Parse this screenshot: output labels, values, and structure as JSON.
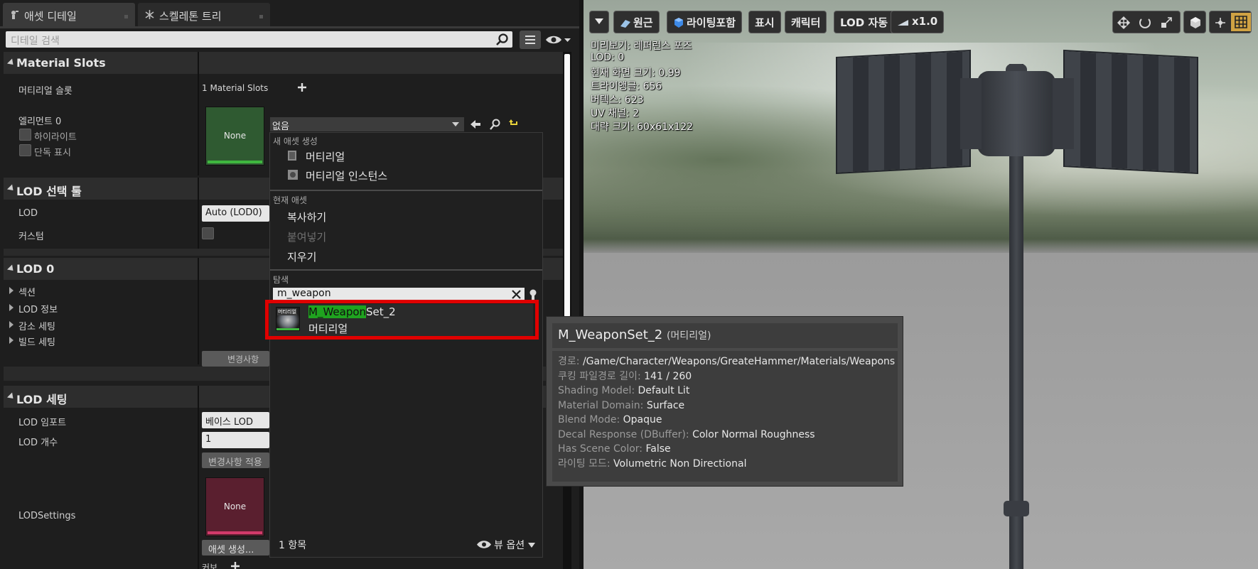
{
  "tabs": [
    {
      "label": "애셋 디테일",
      "active": true
    },
    {
      "label": "스켈레톤 트리",
      "active": false
    }
  ],
  "details": {
    "search_placeholder": "디테일 검색",
    "categories": {
      "material_slots": "Material Slots",
      "lod_picker": "LOD 선택 툴",
      "lod0": "LOD 0",
      "lod_settings": "LOD 세팅"
    },
    "material_slots": {
      "label": "머티리얼 슬롯",
      "value": "1 Material Slots",
      "element_label": "엘리먼트 0",
      "highlight_label": "하이라이트",
      "isolate_label": "단독 표시",
      "thumb_text": "None",
      "combo_value": "없음"
    },
    "lod_picker": {
      "lod_label": "LOD",
      "lod_value": "Auto (LOD0)",
      "custom_label": "커스텀"
    },
    "lod0": {
      "sections": [
        "섹션",
        "LOD 정보",
        "감소 세팅",
        "빌드 세팅"
      ],
      "apply_button": "변경사항 적"
    },
    "lod_settings": {
      "import_label": "LOD 임포트",
      "import_value": "베이스 LOD",
      "count_label": "LOD 개수",
      "count_value": "1",
      "apply_button": "변경사항 적용",
      "settings_label": "LODSettings",
      "thumb_text": "None",
      "create_button": "애셋 생성...",
      "bottom_label": "커보"
    }
  },
  "menu": {
    "create_header": "새 애셋 생성",
    "create_items": [
      "머티리얼",
      "머티리얼 인스턴스"
    ],
    "current_header": "현재 애셋",
    "current_items": [
      {
        "label": "복사하기",
        "enabled": true
      },
      {
        "label": "붙여넣기",
        "enabled": false
      },
      {
        "label": "지우기",
        "enabled": true
      }
    ],
    "browse_header": "탐색",
    "filter_value": "m_weapon",
    "result": {
      "name_match": "M_Weapon",
      "name_rest": "Set_2",
      "type": "머티리얼",
      "thumb_label": "머티리얼"
    },
    "count": "1 항목",
    "view_options": "뷰 옵션"
  },
  "viewport": {
    "toolbar": [
      "원근",
      "라이팅포함",
      "표시",
      "캐릭터",
      "LOD 자동",
      "x1.0"
    ],
    "stats": [
      "미리보기: 레퍼런스 포즈",
      "LOD: 0",
      "현재 화면 크기: 0.99",
      "트라이앵글: 656",
      "버텍스: 623",
      "UV 채널: 2",
      "대략 크기: 60x61x122"
    ]
  },
  "tooltip": {
    "title": "M_WeaponSet_2",
    "title_type": "(머티리얼)",
    "rows": [
      {
        "k": "경로:",
        "v": "/Game/Character/Weapons/GreateHammer/Materials/Weapons"
      },
      {
        "k": "쿠킹 파일경로 길이:",
        "v": "141 / 260"
      },
      {
        "k": "Shading Model:",
        "v": "Default Lit"
      },
      {
        "k": "Material Domain:",
        "v": "Surface"
      },
      {
        "k": "Blend Mode:",
        "v": "Opaque"
      },
      {
        "k": "Decal Response (DBuffer):",
        "v": "Color Normal Roughness"
      },
      {
        "k": "Has Scene Color:",
        "v": "False"
      },
      {
        "k": "라이팅 모드:",
        "v": "Volumetric Non Directional"
      }
    ]
  },
  "colors": {
    "highlight": "#e00000",
    "search_match": "#1fa31f",
    "slot_thumb": "#2f5a31",
    "lod_thumb": "#5a1f2f"
  }
}
